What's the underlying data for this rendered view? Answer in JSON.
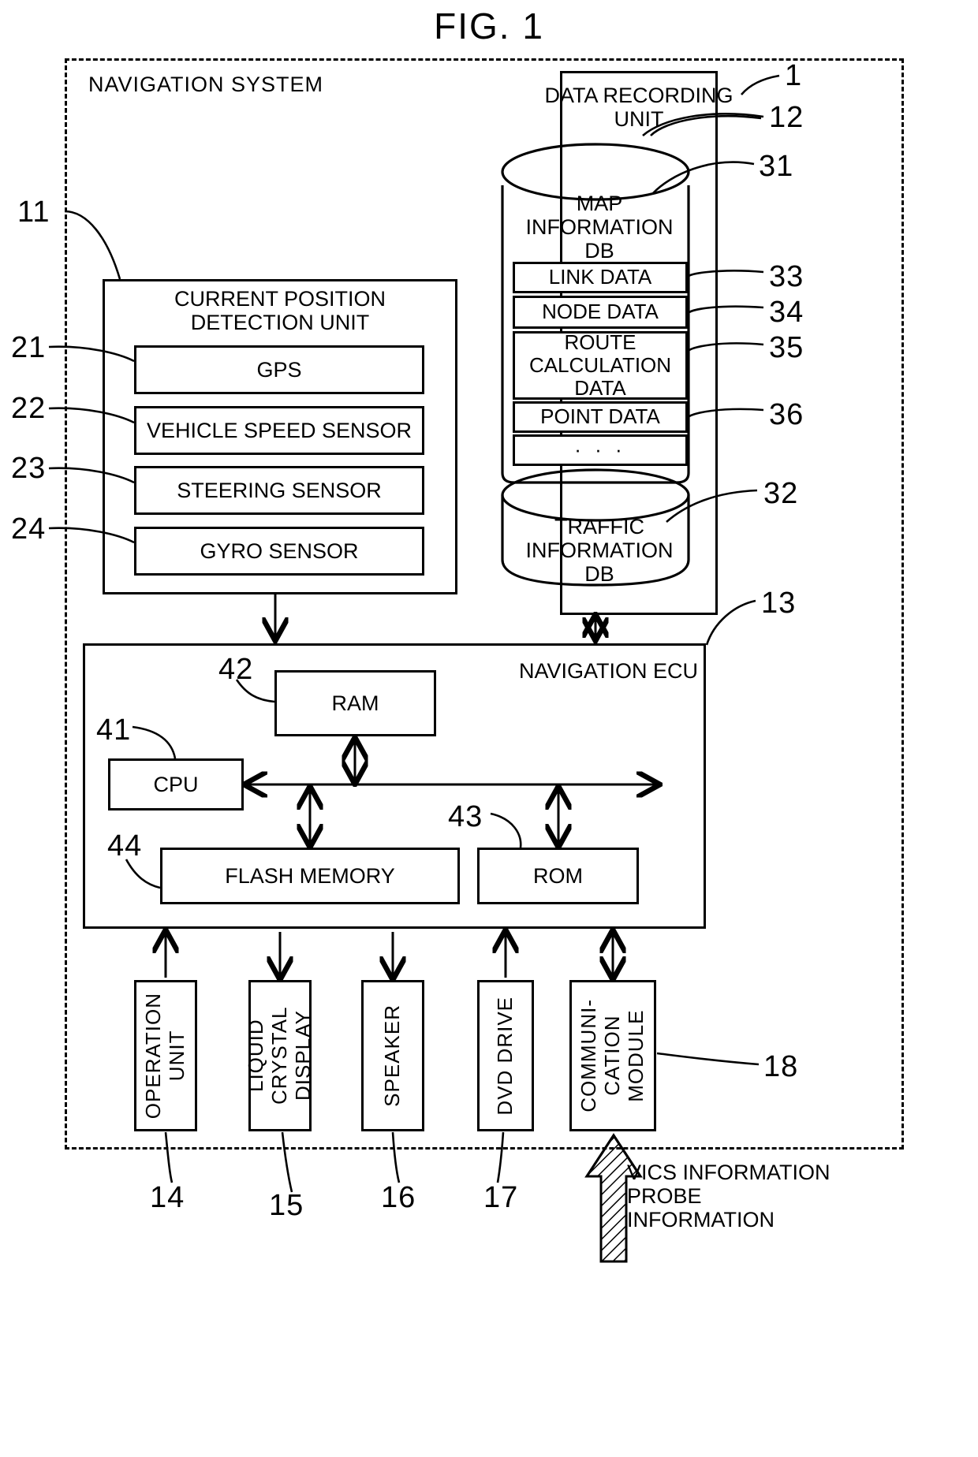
{
  "figure": {
    "title": "FIG. 1",
    "system_label": "NAVIGATION SYSTEM",
    "system_ref": "1"
  },
  "data_recording_unit": {
    "title": "DATA RECORDING\nUNIT",
    "ref": "12",
    "map_db": {
      "label": "MAP\nINFORMATION\nDB",
      "ref": "31",
      "rows": [
        {
          "label": "LINK DATA",
          "ref": "33"
        },
        {
          "label": "NODE DATA",
          "ref": "34"
        },
        {
          "label": "ROUTE\nCALCULATION\nDATA",
          "ref": "35"
        },
        {
          "label": "POINT DATA",
          "ref": "36"
        },
        {
          "label": "· · ·",
          "ref": ""
        }
      ]
    },
    "traffic_db": {
      "label": "TRAFFIC\nINFORMATION\nDB",
      "ref": "32"
    }
  },
  "current_position_detection_unit": {
    "title": "CURRENT POSITION\nDETECTION UNIT",
    "ref": "11",
    "sensors": [
      {
        "label": "GPS",
        "ref": "21"
      },
      {
        "label": "VEHICLE SPEED SENSOR",
        "ref": "22"
      },
      {
        "label": "STEERING SENSOR",
        "ref": "23"
      },
      {
        "label": "GYRO SENSOR",
        "ref": "24"
      }
    ]
  },
  "navigation_ecu": {
    "title": "NAVIGATION ECU",
    "ref": "13",
    "blocks": [
      {
        "label": "RAM",
        "ref": "42"
      },
      {
        "label": "CPU",
        "ref": "41"
      },
      {
        "label": "FLASH MEMORY",
        "ref": "44"
      },
      {
        "label": "ROM",
        "ref": "43"
      }
    ]
  },
  "peripherals": [
    {
      "label": "OPERATION\nUNIT",
      "ref": "14"
    },
    {
      "label": "LIQUID CRYSTAL\nDISPLAY",
      "ref": "15"
    },
    {
      "label": "SPEAKER",
      "ref": "16"
    },
    {
      "label": "DVD DRIVE",
      "ref": "17"
    },
    {
      "label": "COMMUNI-\nCATION\nMODULE",
      "ref": "18"
    }
  ],
  "external_input": {
    "lines": "VICS INFORMATION\nPROBE\nINFORMATION"
  }
}
